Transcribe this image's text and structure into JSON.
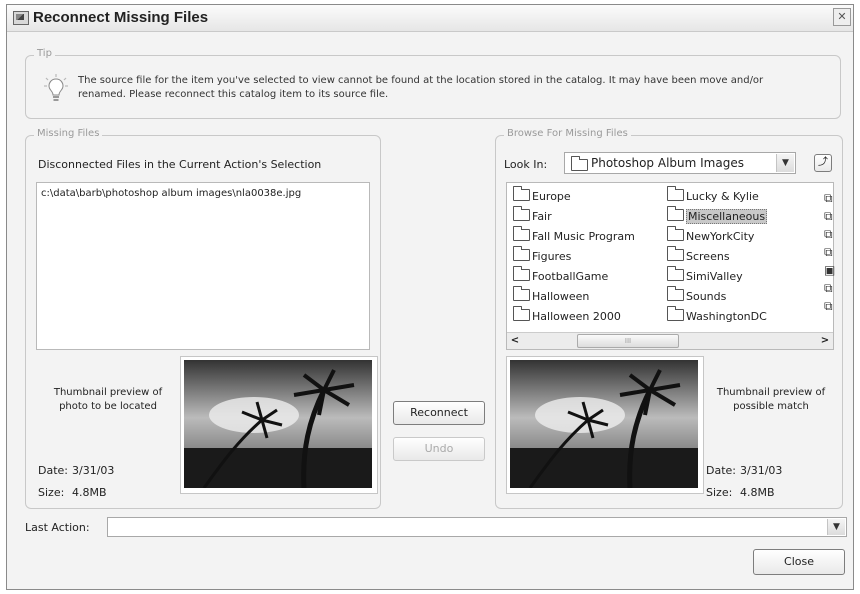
{
  "window": {
    "title": "Reconnect Missing Files",
    "close_glyph": "✕"
  },
  "tip": {
    "legend": "Tip",
    "icon": "lightbulb-icon",
    "text": "The source file for the item you've selected to view cannot be found at the location stored in the catalog. It may have been move and/or renamed. Please reconnect this catalog item to its source file."
  },
  "missing": {
    "legend": "Missing Files",
    "heading": "Disconnected Files in the Current Action's Selection",
    "files": [
      "c:\\data\\barb\\photoshop album images\\nla0038e.jpg"
    ],
    "thumb_caption": "Thumbnail preview of photo to be located",
    "date_label": "Date:",
    "date_value": "3/31/03",
    "size_label": "Size:",
    "size_value": "4.8MB"
  },
  "actions": {
    "reconnect": "Reconnect",
    "undo": "Undo"
  },
  "browse": {
    "legend": "Browse For Missing Files",
    "look_in_label": "Look In:",
    "look_in_value": "Photoshop Album Images",
    "folders_left": [
      "Europe",
      "Fair",
      "Fall Music Program",
      "Figures",
      "FootballGame",
      "Halloween",
      "Halloween 2000"
    ],
    "folders_right": [
      "Lucky & Kylie",
      "Miscellaneous",
      "NewYorkCity",
      "Screens",
      "SimiValley",
      "Sounds",
      "WashingtonDC"
    ],
    "selected_folder": "Miscellaneous",
    "scroll_left": "<",
    "scroll_right": ">",
    "scroll_thumb": "III",
    "thumb_caption": "Thumbnail preview of possible match",
    "date_label": "Date:",
    "date_value": "3/31/03",
    "size_label": "Size:",
    "size_value": "4.8MB"
  },
  "last_action": {
    "label": "Last Action:",
    "value": ""
  },
  "close_button": "Close"
}
